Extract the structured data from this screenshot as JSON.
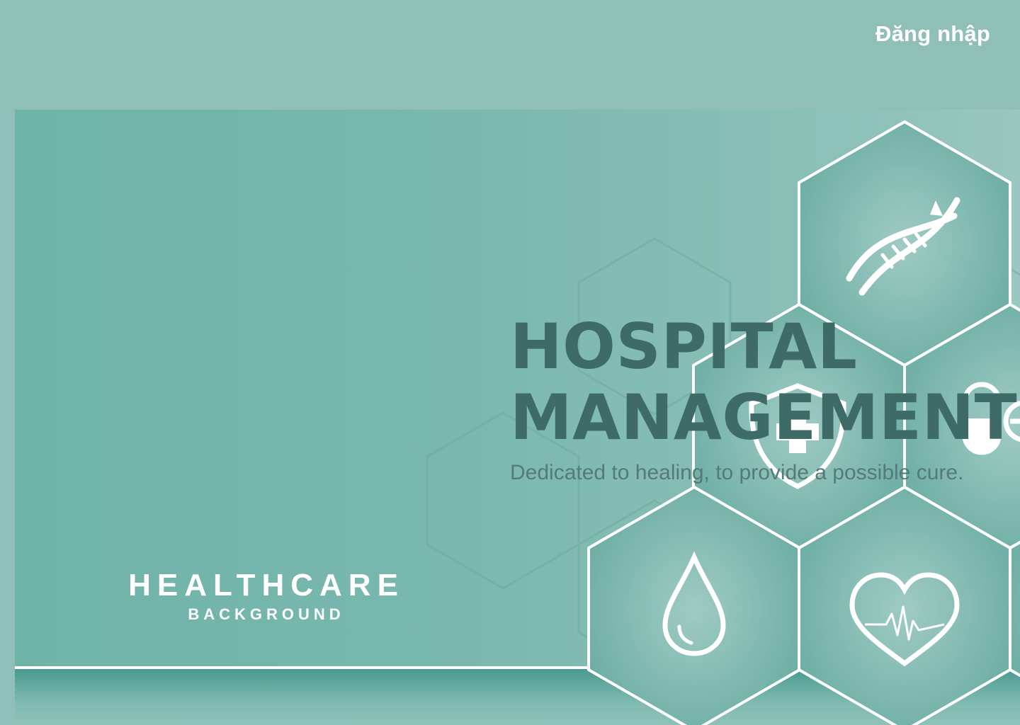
{
  "header": {
    "login_label": "Đăng nhập"
  },
  "hero": {
    "title_line1": "HOSPITAL",
    "title_line2": "MANAGEMENT",
    "subtitle": "Dedicated to healing, to provide a possible cure."
  },
  "banner": {
    "brand_main": "HEALTHCARE",
    "brand_sub": "BACKGROUND",
    "icons": [
      "dna-icon",
      "shield-cross-icon",
      "capsule-icon",
      "water-drop-icon",
      "heart-pulse-icon"
    ]
  },
  "colors": {
    "background": "#8fbfb8",
    "banner": "#7ab8ae",
    "title_text": "#3e6a68",
    "subtitle_text": "#557a78",
    "login_text": "#ffffff"
  }
}
